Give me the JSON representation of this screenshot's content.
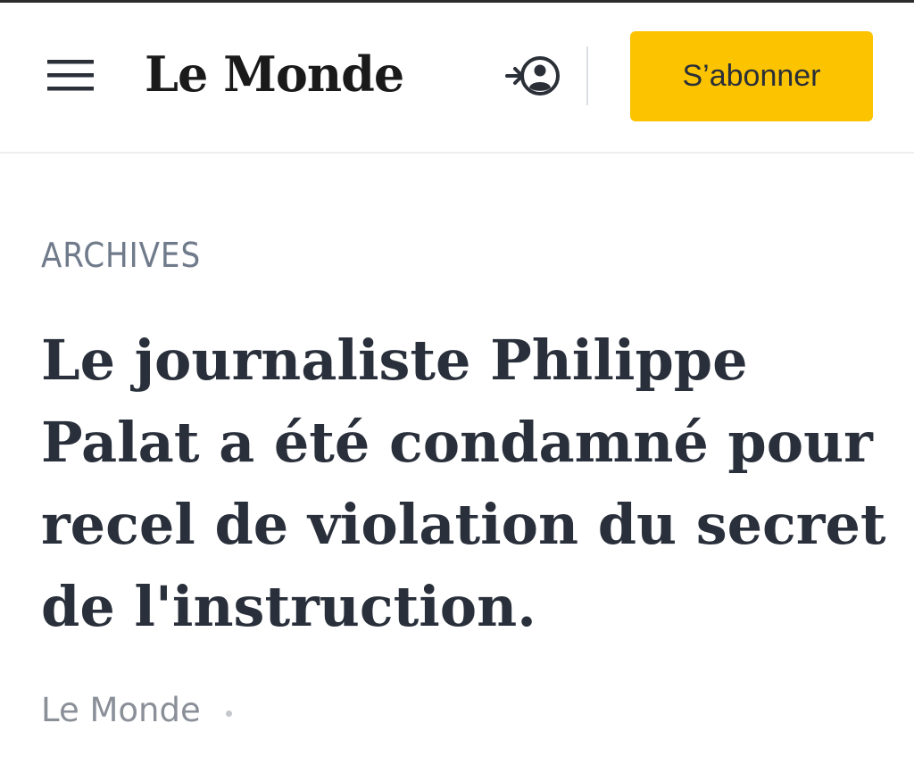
{
  "header": {
    "menu_icon": "hamburger-menu-icon",
    "logo_text": "Le Monde",
    "login_icon": "login-account-icon",
    "subscribe_label": "S’abonner",
    "accent_color": "#fcc400"
  },
  "article": {
    "kicker": "ARCHIVES",
    "headline": "Le journaliste Philippe Palat a été condamné pour recel de violation du secret de l'instruction.",
    "byline": "Le Monde"
  }
}
